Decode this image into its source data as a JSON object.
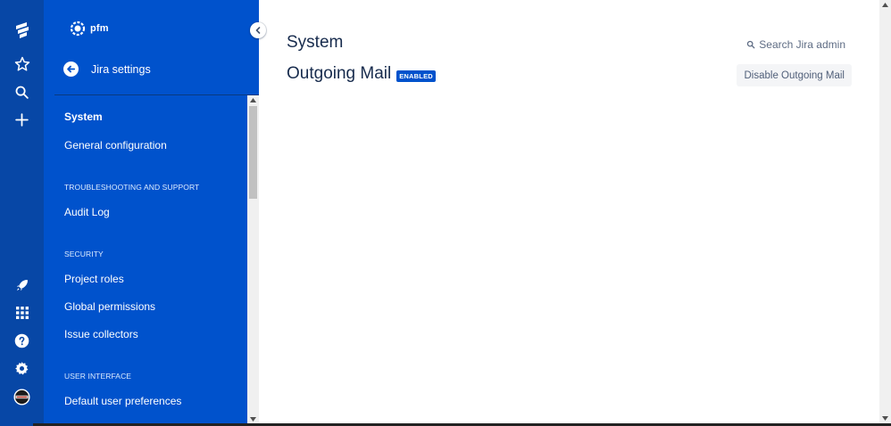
{
  "colors": {
    "global_nav": "#0747a6",
    "sidebar": "#0052cc",
    "lozenge": "#0052cc",
    "title_text": "#172b4d"
  },
  "global_nav": {
    "items": [
      {
        "icon": "jira-logo-icon"
      },
      {
        "icon": "star-icon"
      },
      {
        "icon": "search-icon"
      },
      {
        "icon": "plus-icon"
      },
      {
        "icon": "rocket-icon"
      },
      {
        "icon": "app-switcher-icon"
      },
      {
        "icon": "help-icon"
      },
      {
        "icon": "gear-icon"
      },
      {
        "icon": "avatar-icon"
      }
    ]
  },
  "sidebar": {
    "logo_text": "pfm",
    "back_label": "Jira settings",
    "items": [
      {
        "type": "item",
        "label": "System",
        "selected": true
      },
      {
        "type": "item",
        "label": "General configuration"
      },
      {
        "type": "section",
        "label": "TROUBLESHOOTING AND SUPPORT"
      },
      {
        "type": "item",
        "label": "Audit Log"
      },
      {
        "type": "section",
        "label": "SECURITY"
      },
      {
        "type": "item",
        "label": "Project roles"
      },
      {
        "type": "item",
        "label": "Global permissions"
      },
      {
        "type": "item",
        "label": "Issue collectors"
      },
      {
        "type": "section",
        "label": "USER INTERFACE"
      },
      {
        "type": "item",
        "label": "Default user preferences"
      }
    ]
  },
  "main": {
    "page_title": "System",
    "search_label": "Search Jira admin",
    "section_title": "Outgoing Mail",
    "status_lozenge": "ENABLED",
    "disable_button": "Disable Outgoing Mail"
  }
}
